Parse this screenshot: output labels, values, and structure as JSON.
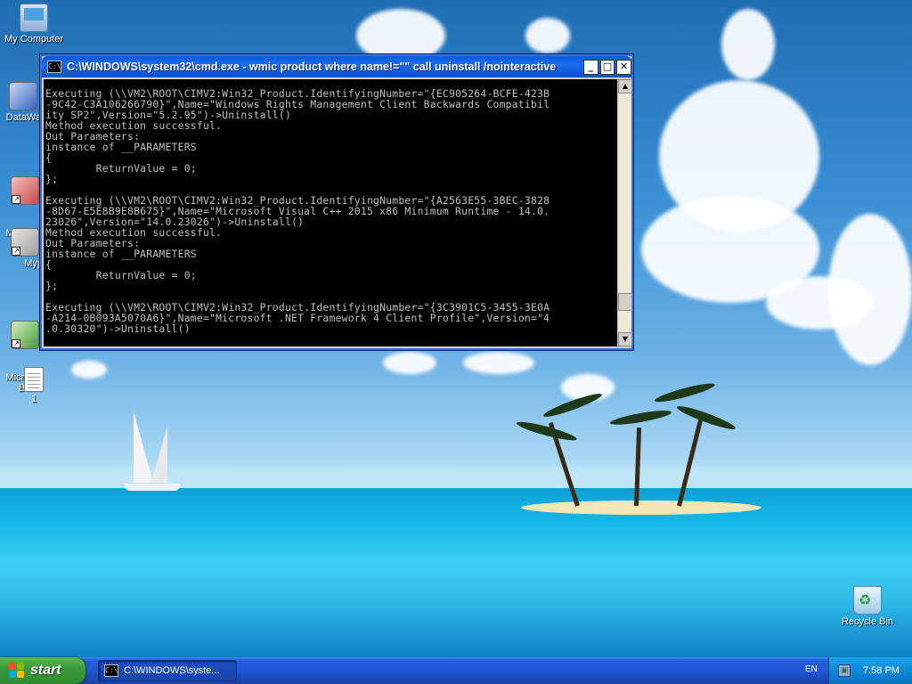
{
  "desktop": {
    "icons": [
      {
        "label": "My Computer"
      },
      {
        "label": "DataWa"
      },
      {
        "label": "Microsof\nC++"
      },
      {
        "label": "Myp"
      },
      {
        "label": "Microsof\nBasic"
      },
      {
        "label": "1"
      },
      {
        "label": "Recycle Bin"
      }
    ]
  },
  "cmd_window": {
    "icon_text": "C:\\",
    "title": "C:\\WINDOWS\\system32\\cmd.exe - wmic product where name!=\"\" call uninstall /nointeractive",
    "buttons": {
      "minimize": "_",
      "maximize": "□",
      "close": "✕"
    },
    "console_lines": [
      "Executing (\\\\VM2\\ROOT\\CIMV2:Win32_Product.IdentifyingNumber=\"{EC905264-BCFE-423B",
      "-9C42-C3A106266790}\",Name=\"Windows Rights Management Client Backwards Compatibil",
      "ity SP2\",Version=\"5.2.95\")->Uninstall()",
      "Method execution successful.",
      "Out Parameters:",
      "instance of __PARAMETERS",
      "{",
      "        ReturnValue = 0;",
      "};",
      "",
      "Executing (\\\\VM2\\ROOT\\CIMV2:Win32_Product.IdentifyingNumber=\"{A2563E55-3BEC-3828",
      "-8D67-E5E8B9E8B675}\",Name=\"Microsoft Visual C++ 2015 x86 Minimum Runtime - 14.0.",
      "23026\",Version=\"14.0.23026\")->Uninstall()",
      "Method execution successful.",
      "Out Parameters:",
      "instance of __PARAMETERS",
      "{",
      "        ReturnValue = 0;",
      "};",
      "",
      "Executing (\\\\VM2\\ROOT\\CIMV2:Win32_Product.IdentifyingNumber=\"{3C3901C5-3455-3E0A",
      "-A214-0B093A5070A6}\",Name=\"Microsoft .NET Framework 4 Client Profile\",Version=\"4",
      ".0.30320\")->Uninstall()"
    ]
  },
  "taskbar": {
    "start_label": "start",
    "task_item_label": "C:\\WINDOWS\\syste...",
    "language": "EN",
    "clock": "7:58 PM"
  },
  "colors": {
    "console_bg": "#000000",
    "console_fg": "#c0c0c0",
    "titlebar": "#0a5cd8",
    "start_green": "#3a9a3a",
    "taskbar_blue": "#245edb"
  }
}
